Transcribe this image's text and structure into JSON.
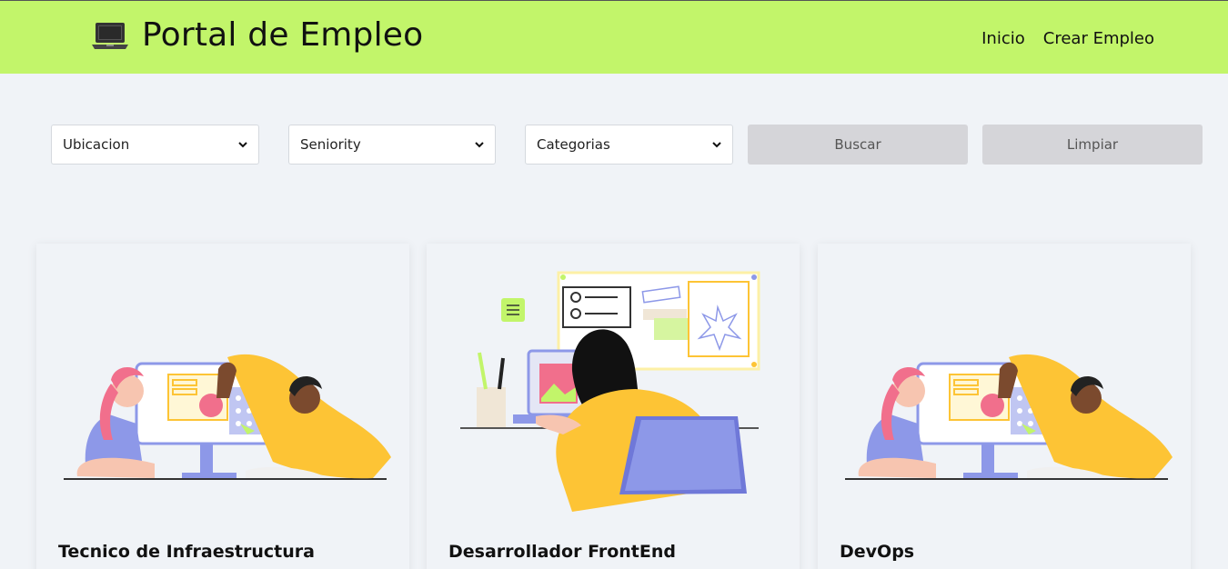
{
  "header": {
    "icon": "laptop-icon",
    "title": "Portal de Empleo",
    "nav": [
      {
        "label": "Inicio"
      },
      {
        "label": "Crear Empleo"
      }
    ],
    "background": "#c2f56a"
  },
  "filters": {
    "ubicacion": {
      "selected": "Ubicacion"
    },
    "seniority": {
      "selected": "Seniority"
    },
    "categorias": {
      "selected": "Categorias"
    }
  },
  "buttons": {
    "search": "Buscar",
    "clear": "Limpiar"
  },
  "jobs": [
    {
      "title": "Tecnico de Infraestructura",
      "illustration": "team-at-monitor-illustration"
    },
    {
      "title": "Desarrollador FrontEnd",
      "illustration": "woman-at-laptop-illustration"
    },
    {
      "title": "DevOps",
      "illustration": "team-at-monitor-illustration"
    }
  ],
  "colors": {
    "accent_yellow": "#fdc435",
    "accent_purple": "#8d98e8",
    "accent_pink": "#f16f8c",
    "button_gray": "#d5d5d9"
  }
}
